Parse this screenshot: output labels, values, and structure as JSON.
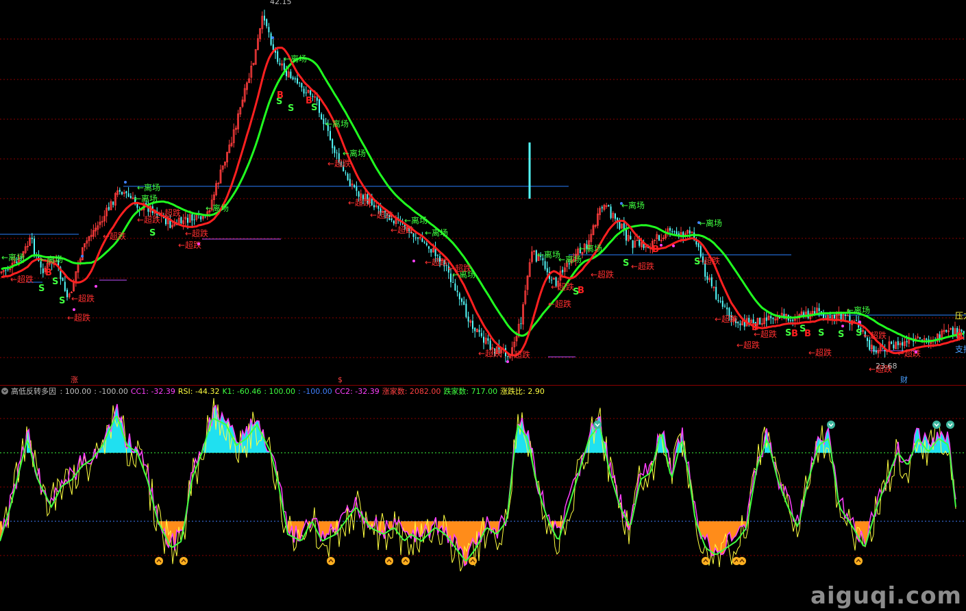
{
  "main_chart": {
    "top_price_label": "42.15",
    "bottom_price_label": "23.68",
    "right_edge_labels": {
      "pressure": "压力",
      "support": "支撑"
    },
    "signals": {
      "leave": "离场",
      "oversold": "超跌",
      "buy": "B",
      "sell": "S"
    },
    "markers": {
      "limit_up": "涨",
      "dividend": "$",
      "finance": "财"
    },
    "colors": {
      "background": "#000000",
      "up_candle": "#ff3c3c",
      "down_candle": "#54ffff",
      "fast_ma": "#ff2020",
      "slow_ma": "#20ff20",
      "grid": "#8b0000",
      "level_line": "#2a7fff",
      "support_line": "#c050ff"
    }
  },
  "indicator": {
    "name": "高低反转多因",
    "values": [
      {
        "label": "",
        "value": ": 100.00",
        "color": "#c0c0c0"
      },
      {
        "label": "",
        "value": ": -100.00",
        "color": "#c0c0c0"
      },
      {
        "label": "CC1",
        "value": ": -32.39",
        "color": "#ff40ff"
      },
      {
        "label": "RSI",
        "value": ": -44.32",
        "color": "#ffff40"
      },
      {
        "label": "K1",
        "value": ": -60.46",
        "color": "#40ff40"
      },
      {
        "label": "",
        "value": ": 100.00",
        "color": "#40ff40"
      },
      {
        "label": "",
        "value": ": -100.00",
        "color": "#4080ff"
      },
      {
        "label": "CC2",
        "value": ": -32.39",
        "color": "#ff40ff"
      },
      {
        "label": "涨家数",
        "value": ": 2082.00",
        "color": "#ff4040"
      },
      {
        "label": "跌家数",
        "value": ": 717.00",
        "color": "#40ff40"
      },
      {
        "label": "涨跌比",
        "value": ": 2.90",
        "color": "#ffff40"
      }
    ],
    "upper_level": 100,
    "lower_level": -100
  },
  "watermark": "aiguqi.com"
}
